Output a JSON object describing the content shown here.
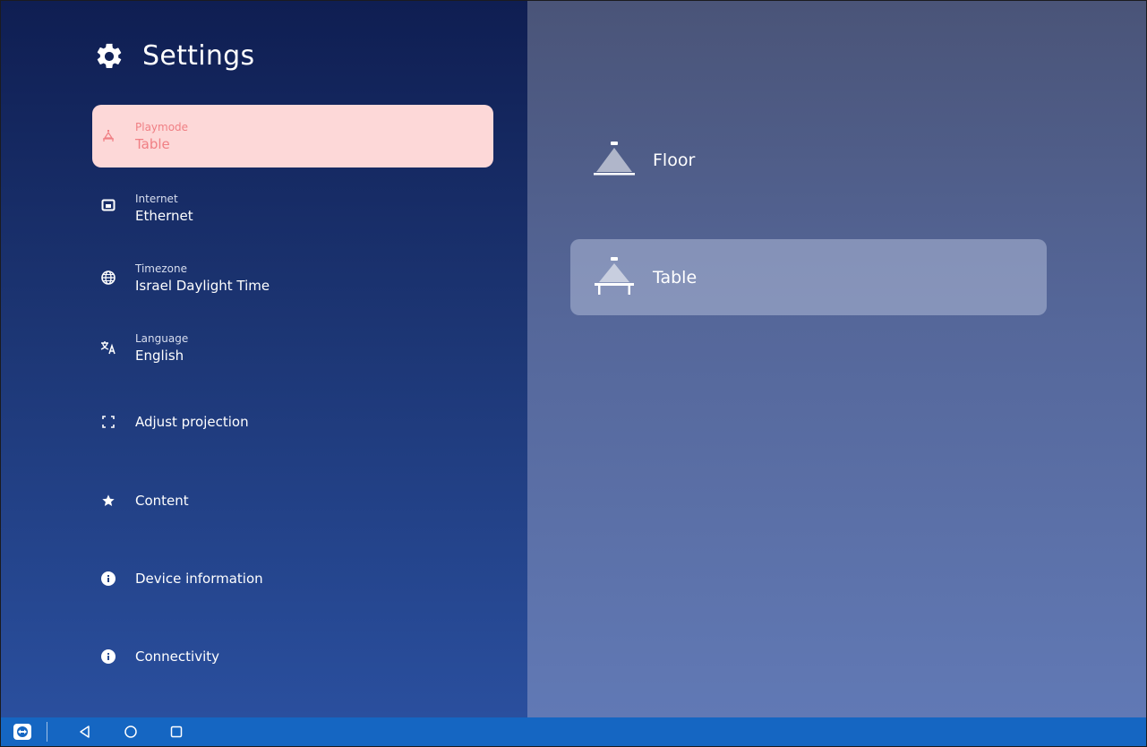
{
  "header": {
    "title": "Settings",
    "icon": "gear-icon"
  },
  "menu": {
    "items": [
      {
        "sub": "Playmode",
        "value": "Table",
        "icon": "table-mode-icon",
        "selected": true
      },
      {
        "sub": "Internet",
        "value": "Ethernet",
        "icon": "ethernet-icon"
      },
      {
        "sub": "Timezone",
        "value": "Israel Daylight Time",
        "icon": "globe-icon"
      },
      {
        "sub": "Language",
        "value": "English",
        "icon": "translate-icon"
      },
      {
        "label": "Adjust projection",
        "icon": "adjust-projection-icon"
      },
      {
        "label": "Content",
        "icon": "star-icon"
      },
      {
        "label": "Device information",
        "icon": "info-icon"
      },
      {
        "label": "Connectivity",
        "icon": "info-icon"
      }
    ]
  },
  "playmode_options": [
    {
      "label": "Floor",
      "icon": "floor-mode-icon",
      "selected": false
    },
    {
      "label": "Table",
      "icon": "table-mode-icon",
      "selected": true
    }
  ],
  "colors": {
    "selected_bg": "#fdd8d8",
    "selected_text": "#f07f84",
    "taskbar": "#1566c2"
  },
  "taskbar": {
    "icons": [
      "teamviewer-icon",
      "back-icon",
      "home-icon",
      "recents-icon"
    ]
  }
}
